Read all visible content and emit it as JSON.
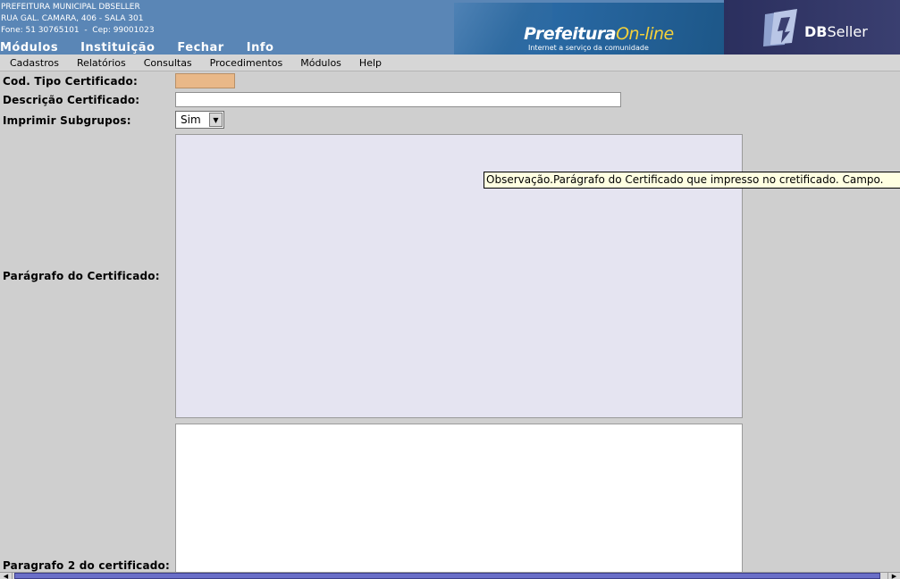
{
  "header": {
    "org_name": "PREFEITURA MUNICIPAL DBSELLER",
    "org_address": "RUA GAL. CAMARA, 406 - SALA 301",
    "org_contact": "Fone: 51 30765101  -  Cep: 99001023",
    "nav": [
      "Módulos",
      "Instituição",
      "Fechar",
      "Info"
    ],
    "banner_brand_main": "Prefeitura",
    "banner_brand_accent": "On-line",
    "banner_tagline": "Internet a serviço da comunidade",
    "logo_text_bold": "DB",
    "logo_text_rest": "Seller"
  },
  "menubar": [
    "Cadastros",
    "Relatórios",
    "Consultas",
    "Procedimentos",
    "Módulos",
    "Help"
  ],
  "form": {
    "cod_label": "Cod. Tipo Certificado:",
    "cod_value": "",
    "desc_label": "Descrição Certificado:",
    "desc_value": "",
    "subgrupos_label": "Imprimir Subgrupos:",
    "subgrupos_value": "Sim",
    "paragrafo_label": "Parágrafo do Certificado:",
    "paragrafo2_label": "Paragrafo 2 do certificado:"
  },
  "tooltip": "Observação.Parágrafo do Certificado que impresso no cretificado. Campo.",
  "colors": {
    "header_bg": "#5a86b6",
    "code_field_bg": "#e9b888",
    "textarea_focus_bg": "#e5e4f1",
    "tooltip_bg": "#ffffe1",
    "scroll_thumb": "#6a6fc8"
  }
}
